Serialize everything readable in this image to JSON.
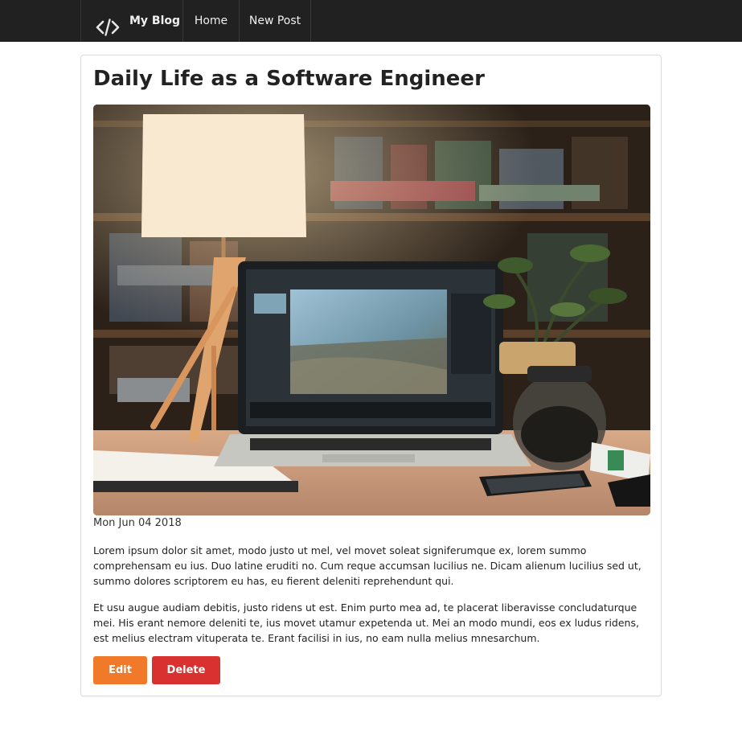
{
  "navbar": {
    "brand_label": "My Blog",
    "brand_icon": "code-icon",
    "home_label": "Home",
    "new_post_label": "New Post"
  },
  "post": {
    "title": "Daily Life as a Software Engineer",
    "image_icon": "photo-desk-laptop",
    "date": "Mon Jun 04 2018",
    "paragraphs": [
      "Lorem ipsum dolor sit amet, modo justo ut mel, vel movet soleat signiferumque ex, lorem summo comprehensam eu ius. Duo latine eruditi no. Cum reque accumsan lucilius ne. Dicam alienum lucilius sed ut, summo dolores scriptorem eu has, eu fierent deleniti reprehendunt qui.",
      "Et usu augue audiam debitis, justo ridens ut est. Enim purto mea ad, te placerat liberavisse concludaturque mei. His erant nemore deleniti te, ius movet utamur expetenda ut. Mei an modo mundi, eos ex ludus ridens, est melius electram vituperata te. Erant facilisi in ius, no eam nulla melius mnesarchum."
    ],
    "edit_label": "Edit",
    "delete_label": "Delete"
  },
  "colors": {
    "navbar_bg": "#212121",
    "edit_button": "#f07a2a",
    "delete_button": "#d93030"
  }
}
